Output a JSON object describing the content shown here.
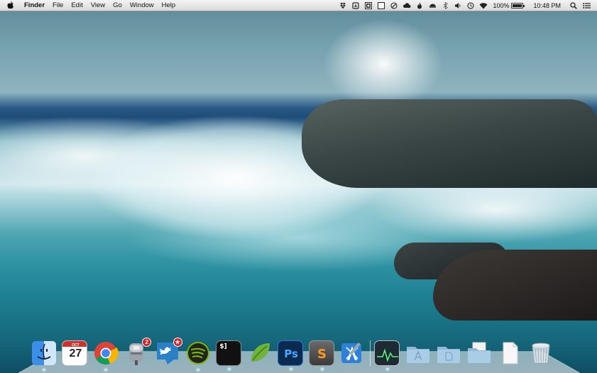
{
  "menubar": {
    "app_name": "Finder",
    "menus": [
      "File",
      "Edit",
      "View",
      "Go",
      "Window",
      "Help"
    ],
    "status_icons": [
      "dropbox-icon",
      "cloud-sync-icon",
      "contrast-icon",
      "window-icon",
      "do-not-disturb-icon",
      "cloud-icon",
      "flame-icon",
      "helmet-icon",
      "bluetooth-icon",
      "volume-icon",
      "time-machine-icon",
      "wifi-icon"
    ],
    "battery_percent": "100%",
    "battery_level": 1.0,
    "clock": "10:48 PM"
  },
  "wallpaper": {
    "description_colors": {
      "sky": "#7fa8b6",
      "sea": "#1f7f92",
      "foam": "#eef8fa",
      "rock": "#2b3536"
    }
  },
  "dock": {
    "apps": [
      {
        "name": "finder-icon",
        "running": true
      },
      {
        "name": "calendar-icon",
        "running": false,
        "month": "OCT",
        "day": "27"
      },
      {
        "name": "chrome-icon",
        "running": true
      },
      {
        "name": "mail-icon",
        "running": false,
        "badge": "2"
      },
      {
        "name": "twitter-icon",
        "running": false,
        "badge": "★"
      },
      {
        "name": "spotify-icon",
        "running": true
      },
      {
        "name": "terminal-icon",
        "running": true,
        "label": "$]"
      },
      {
        "name": "evernote-icon",
        "running": false
      },
      {
        "name": "photoshop-icon",
        "running": true,
        "label": "Ps"
      },
      {
        "name": "sublime-text-icon",
        "running": true,
        "label": "S"
      },
      {
        "name": "xcode-icon",
        "running": false
      }
    ],
    "folders": [
      {
        "name": "activity-monitor-icon"
      },
      {
        "name": "applications-folder-icon"
      },
      {
        "name": "documents-folder-icon"
      },
      {
        "name": "downloads-folder-icon"
      },
      {
        "name": "document-stack-icon"
      },
      {
        "name": "trash-icon"
      }
    ]
  }
}
